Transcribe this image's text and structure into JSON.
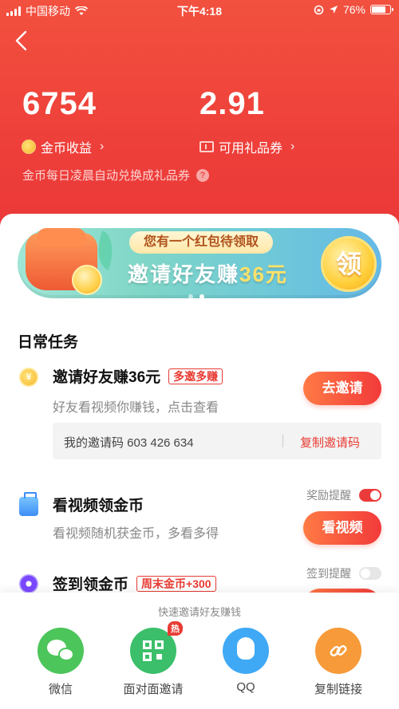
{
  "status_bar": {
    "carrier": "中国移动",
    "time": "下午4:18",
    "battery": "76%"
  },
  "header": {
    "coins_value": "6754",
    "coins_label": "金币收益",
    "vouchers_value": "2.91",
    "vouchers_label": "可用礼品券",
    "note": "金币每日凌晨自动兑换成礼品券"
  },
  "banner": {
    "tag": "您有一个红包待领取",
    "title_prefix": "邀请好友赚",
    "title_amount": "36元",
    "button": "领",
    "slide_count": 2,
    "active_slide": 2
  },
  "daily_tasks": {
    "title": "日常任务",
    "invite": {
      "title": "邀请好友赚36元",
      "badge": "多邀多赚",
      "subtitle": "好友看视频你赚钱，点击查看",
      "button": "去邀请",
      "code_label": "我的邀请码 603 426 634",
      "copy_label": "复制邀请码"
    },
    "video": {
      "title": "看视频领金币",
      "subtitle": "看视频随机获金币，多看多得",
      "button": "看视频",
      "reminder_label": "奖励提醒",
      "reminder_on": true
    },
    "signin": {
      "title": "签到领金币",
      "badge": "周末金币+300",
      "reminder_label": "签到提醒",
      "reminder_on": false
    }
  },
  "share_panel": {
    "title": "快速邀请好友赚钱",
    "items": [
      {
        "label": "微信",
        "icon": "wechat-icon",
        "color": "#4cc55a"
      },
      {
        "label": "面对面邀请",
        "icon": "qr-code-icon",
        "color": "#3bbf6a",
        "badge": "热"
      },
      {
        "label": "QQ",
        "icon": "qq-icon",
        "color": "#3fa9f5"
      },
      {
        "label": "复制链接",
        "icon": "link-icon",
        "color": "#f79a3a"
      }
    ]
  },
  "colors": {
    "header_red": "#ee3f3a",
    "accent_red": "#e93b33",
    "button_gradient_start": "#ff7a45",
    "button_gradient_end": "#f23a3a"
  }
}
